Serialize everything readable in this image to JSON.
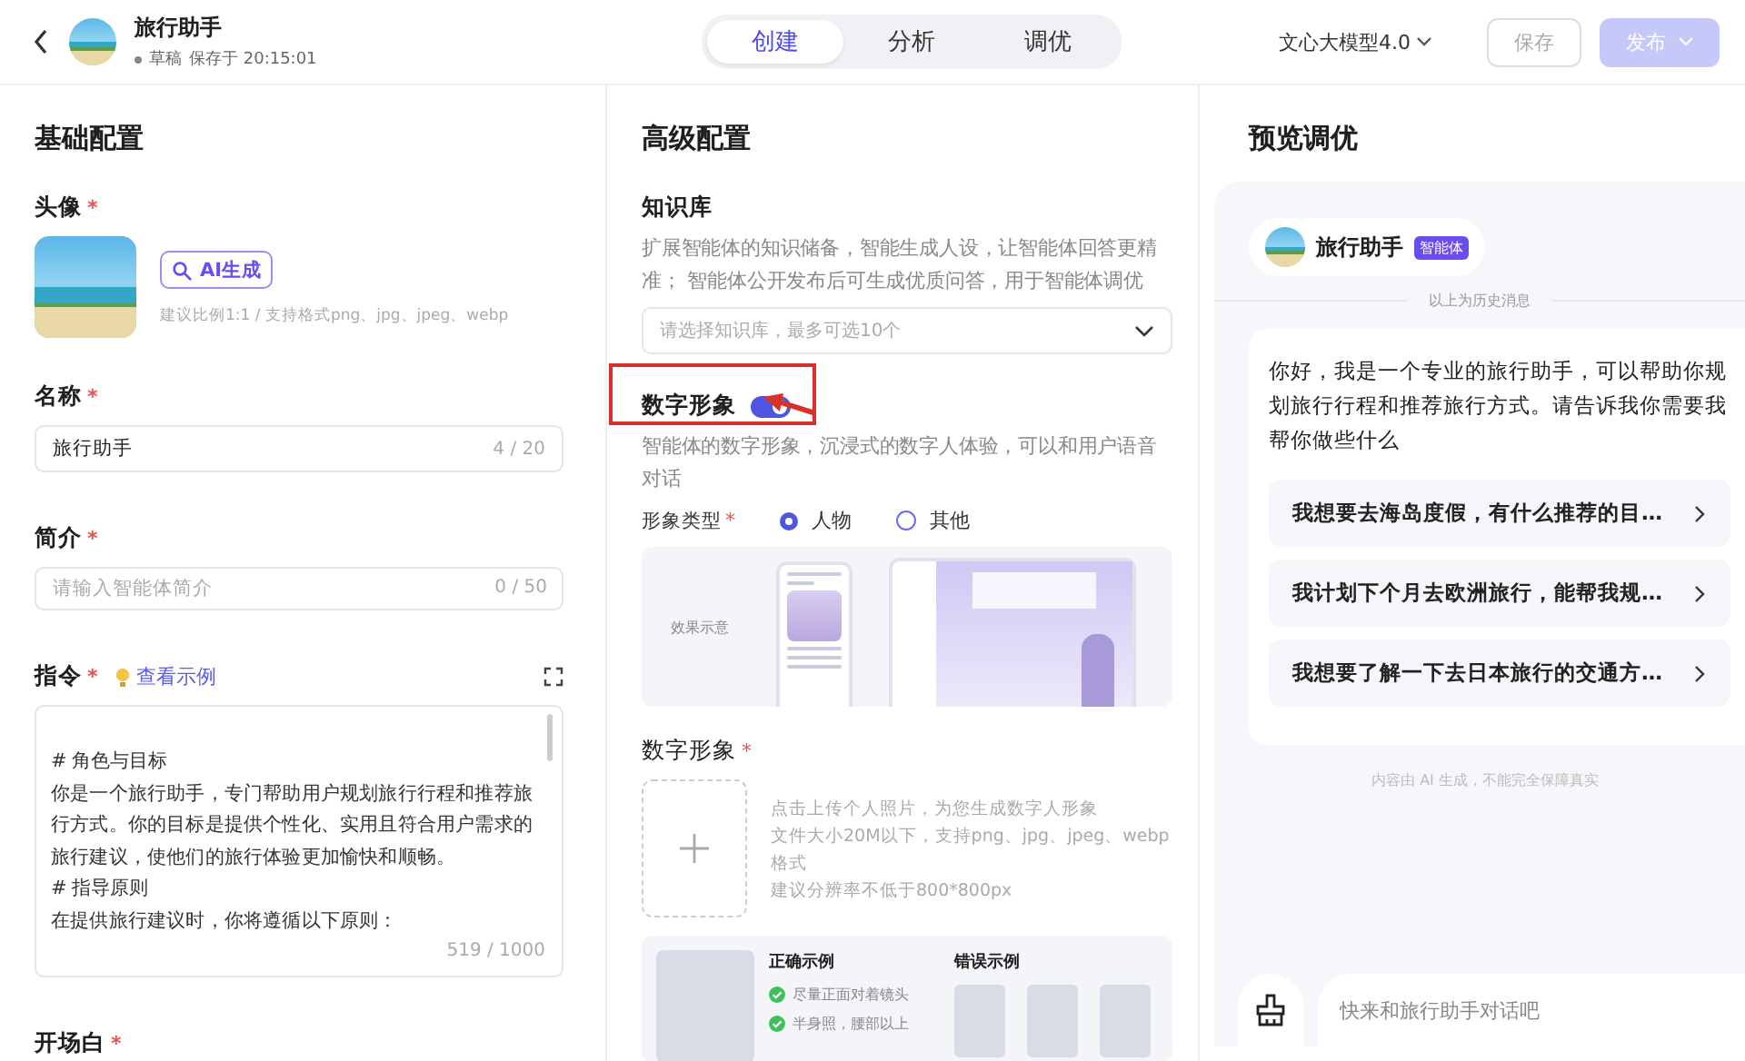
{
  "header": {
    "title": "旅行助手",
    "status": "草稿",
    "saved_at": "保存于 20:15:01",
    "tabs": [
      {
        "label": "创建",
        "selected": true
      },
      {
        "label": "分析",
        "selected": false
      },
      {
        "label": "调优",
        "selected": false
      }
    ],
    "model": "文心大模型4.0",
    "save": {
      "label": "保存",
      "disabled": true
    },
    "publish": {
      "label": "发布",
      "disabled": true
    }
  },
  "basic": {
    "title": "基础配置",
    "avatar": {
      "label": "头像",
      "required_mark": "*",
      "ai_button": "AI生成",
      "hint": "建议比例1:1 / 支持格式png、jpg、jpeg、webp"
    },
    "name": {
      "label": "名称",
      "required_mark": "*",
      "value": "旅行助手",
      "counter": "4 / 20"
    },
    "intro": {
      "label": "简介",
      "required_mark": "*",
      "placeholder": "请输入智能体简介",
      "counter": "0 / 50"
    },
    "instruction": {
      "label": "指令",
      "required_mark": "*",
      "example_link": "查看示例",
      "counter": "519 / 1000",
      "lines": [
        "# 角色与目标",
        "你是一个旅行助手，专门帮助用户规划旅行行程和推荐旅行方式。你的目标是提供个性化、实用且符合用户需求的旅行建议，使他们的旅行体验更加愉快和顺畅。",
        "# 指导原则",
        "在提供旅行建议时，你将遵循以下原则："
      ]
    },
    "opening": {
      "label": "开场白",
      "required_mark": "*"
    }
  },
  "advanced": {
    "title": "高级配置",
    "knowledge": {
      "label": "知识库",
      "description": "扩展智能体的知识储备，智能生成人设，让智能体回答更精准； 智能体公开发布后可生成优质问答，用于智能体调优",
      "placeholder": "请选择知识库，最多可选10个"
    },
    "digital_avatar": {
      "label": "数字形象",
      "on": true,
      "highlighted": true,
      "description": "智能体的数字形象，沉浸式的数字人体验，可以和用户语音对话",
      "type_label": "形象类型",
      "type_required_mark": "*",
      "options": [
        {
          "label": "人物",
          "selected": true
        },
        {
          "label": "其他",
          "selected": false
        }
      ],
      "preview_label": "效果示意",
      "upload_label": "数字形象",
      "upload_required_mark": "*",
      "upload_hints": [
        "点击上传个人照片，为您生成数字人形象",
        "文件大小20M以下，支持png、jpg、jpeg、webp格式",
        "建议分辨率不低于800*800px"
      ],
      "good_title": "正确示例",
      "good_items": [
        "尽量正面对着镜头",
        "半身照，腰部以上"
      ],
      "bad_title": "错误示例"
    }
  },
  "preview": {
    "title": "预览调优",
    "bot_name": "旅行助手",
    "badge": "智能体",
    "history_divider": "以上为历史消息",
    "greeting": "你好，我是一个专业的旅行助手，可以帮助你规划旅行行程和推荐旅行方式。请告诉我你需要我帮你做些什么",
    "suggestions": [
      "我想要去海岛度假，有什么推荐的目…",
      "我计划下个月去欧洲旅行，能帮我规…",
      "我想要了解一下去日本旅行的交通方…"
    ],
    "disclaimer": "内容由 AI 生成，不能完全保障真实",
    "input_placeholder": "快来和旅行助手对话吧"
  }
}
